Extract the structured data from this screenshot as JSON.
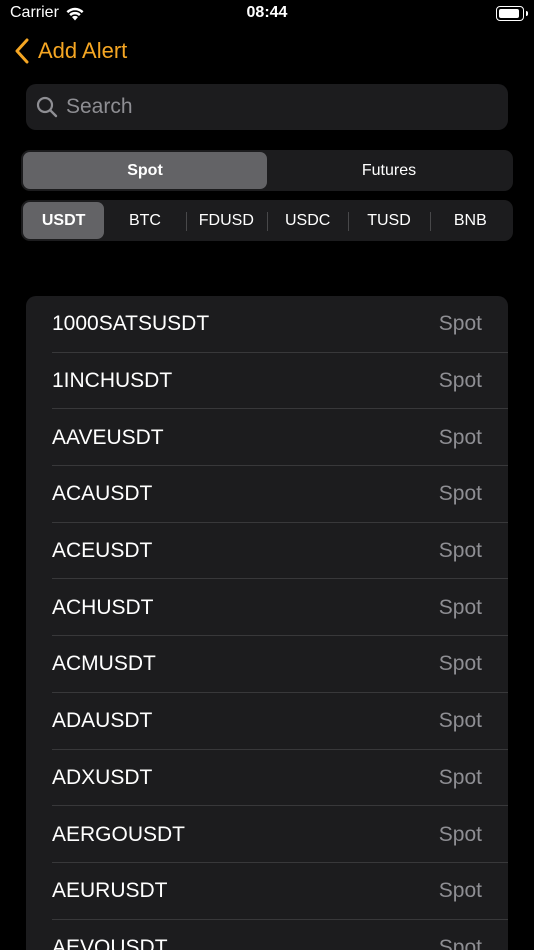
{
  "status": {
    "carrier": "Carrier",
    "time": "08:44",
    "battery_level": 0.92
  },
  "nav": {
    "title": "Add Alert"
  },
  "search": {
    "placeholder": "Search",
    "value": ""
  },
  "market_tabs": [
    {
      "label": "Spot",
      "active": true
    },
    {
      "label": "Futures",
      "active": false
    }
  ],
  "quote_tabs": [
    {
      "label": "USDT",
      "active": true
    },
    {
      "label": "BTC",
      "active": false
    },
    {
      "label": "FDUSD",
      "active": false
    },
    {
      "label": "USDC",
      "active": false
    },
    {
      "label": "TUSD",
      "active": false
    },
    {
      "label": "BNB",
      "active": false
    }
  ],
  "pairs": [
    {
      "symbol": "1000SATSUSDT",
      "market": "Spot"
    },
    {
      "symbol": "1INCHUSDT",
      "market": "Spot"
    },
    {
      "symbol": "AAVEUSDT",
      "market": "Spot"
    },
    {
      "symbol": "ACAUSDT",
      "market": "Spot"
    },
    {
      "symbol": "ACEUSDT",
      "market": "Spot"
    },
    {
      "symbol": "ACHUSDT",
      "market": "Spot"
    },
    {
      "symbol": "ACMUSDT",
      "market": "Spot"
    },
    {
      "symbol": "ADAUSDT",
      "market": "Spot"
    },
    {
      "symbol": "ADXUSDT",
      "market": "Spot"
    },
    {
      "symbol": "AERGOUSDT",
      "market": "Spot"
    },
    {
      "symbol": "AEURUSDT",
      "market": "Spot"
    },
    {
      "symbol": "AEVOUSDT",
      "market": "Spot"
    }
  ],
  "colors": {
    "accent": "#f5a623",
    "background": "#000000",
    "surface": "#1c1c1e",
    "secondary_text": "#8e8e93"
  }
}
